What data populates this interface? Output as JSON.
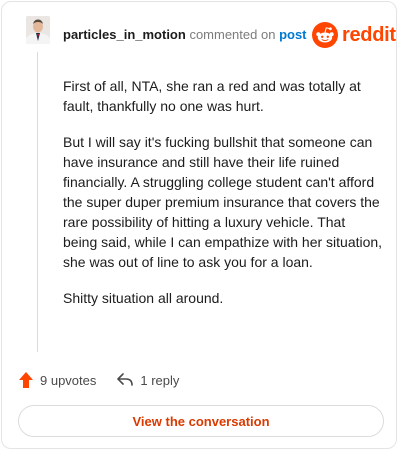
{
  "comment": {
    "username": "particles_in_motion",
    "commented_on_text": "commented on",
    "post_link_text": "post",
    "paragraphs": [
      "First of all, NTA, she ran a red and was totally at fault, thankfully no one was hurt.",
      "But I will say it's fucking bullshit that someone can have insurance and still have their life ruined financially. A struggling college student can't afford the super duper premium insurance that covers the rare possibility of hitting a luxury vehicle. That being said, while I can empathize with her situation, she was out of line to ask you for a loan.",
      "Shitty situation all around."
    ]
  },
  "brand": {
    "wordmark": "reddit",
    "icon": "reddit-alien-icon",
    "color": "#ff4500"
  },
  "actions": {
    "upvotes_label": "9 upvotes",
    "upvote_icon": "upvote-arrow-icon",
    "upvote_color": "#ff4500",
    "replies_label": "1 reply",
    "reply_icon": "reply-arrow-icon"
  },
  "cta": {
    "label": "View the conversation",
    "color": "#d93a00"
  }
}
